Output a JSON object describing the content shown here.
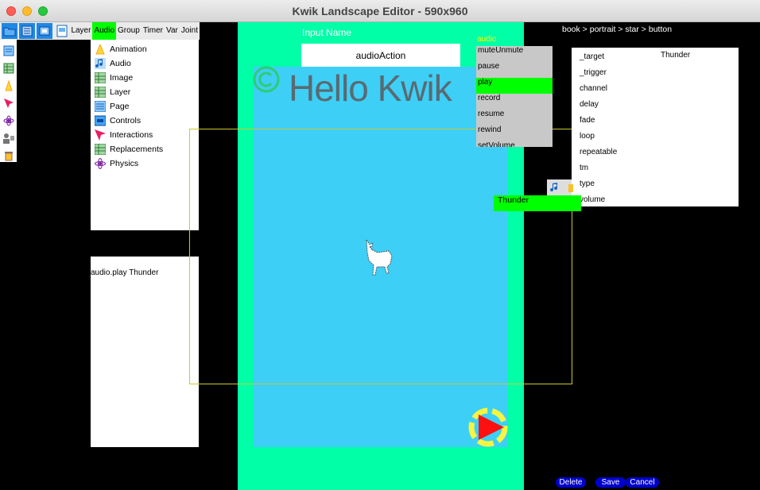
{
  "window": {
    "title": "Kwik Landscape Editor - 590x960"
  },
  "toolbar": {
    "tabs": [
      "Layer",
      "Audio",
      "Group",
      "Timer",
      "Var",
      "Joint"
    ],
    "active_tab": "Audio"
  },
  "layer_menu": {
    "items": [
      {
        "label": "Animation",
        "icon": "animation-icon"
      },
      {
        "label": "Audio",
        "icon": "audio-icon"
      },
      {
        "label": "Image",
        "icon": "image-icon"
      },
      {
        "label": "Layer",
        "icon": "layer-icon"
      },
      {
        "label": "Page",
        "icon": "page-icon"
      },
      {
        "label": "Controls",
        "icon": "controls-icon"
      },
      {
        "label": "Interactions",
        "icon": "interactions-icon"
      },
      {
        "label": "Replacements",
        "icon": "replacements-icon"
      },
      {
        "label": "Physics",
        "icon": "physics-icon"
      }
    ]
  },
  "log": {
    "line": "audio.play Thunder"
  },
  "canvas": {
    "input_label": "Input Name",
    "input_value": "audioAction",
    "hello_text": "Hello Kwik"
  },
  "audio_actions": {
    "label": "audio",
    "items": [
      "muteUnmute",
      "pause",
      "play",
      "record",
      "resume",
      "rewind",
      "setVolume"
    ],
    "active": "play"
  },
  "breadcrumb": "book > portrait  > star > button",
  "properties": {
    "keys": [
      "_target",
      "_trigger",
      "channel",
      "delay",
      "fade",
      "loop",
      "repeatable",
      "tm",
      "type",
      "volume"
    ],
    "target_value": "Thunder"
  },
  "selected_asset": "Thunder",
  "buttons": {
    "delete": "Delete",
    "save": "Save",
    "cancel": "Cancel"
  },
  "colors": {
    "page_bg": "#00ffa6",
    "stage_bg": "#3ecff6",
    "active": "#00ff00",
    "button": "#0000cc"
  }
}
